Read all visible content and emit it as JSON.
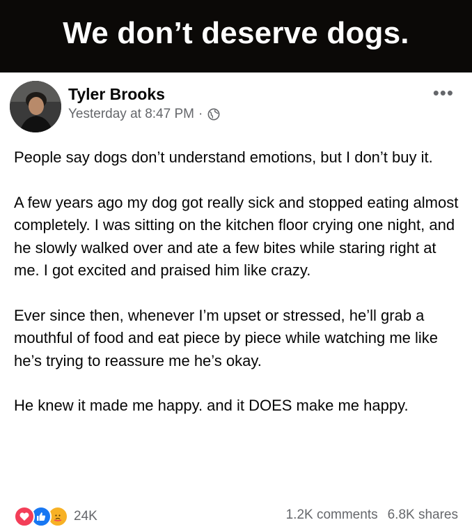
{
  "banner": {
    "text": "We don’t deserve dogs."
  },
  "post": {
    "author": "Tyler Brooks",
    "timestamp": "Yesterday at 8:47 PM",
    "separator": "·",
    "privacy_icon": "globe-icon",
    "more_label": "•••",
    "paragraphs": [
      "People say dogs don’t understand emotions, but I don’t buy it.",
      "A few years ago my dog got really sick and stopped eating almost completely. I was sitting on the kitchen floor crying one night, and he slowly walked over and ate a few bites while staring right at me. I got excited and praised him like crazy.",
      "Ever since then, whenever I’m upset or stressed, he’ll grab a mouthful of food and eat piece by piece while watching me like he’s trying to reassure me he’s okay.",
      "He knew it made me happy. and it DOES make me happy."
    ],
    "reactions": {
      "icons": [
        "love-icon",
        "like-icon",
        "care-icon"
      ],
      "count": "24K"
    },
    "comments": "1.2K comments",
    "shares": "6.8K shares"
  },
  "colors": {
    "banner_bg": "#0b0907",
    "text_primary": "#050505",
    "text_secondary": "#65676b",
    "love": "#f33e58",
    "like": "#1877f2",
    "care": "#f7b125"
  }
}
